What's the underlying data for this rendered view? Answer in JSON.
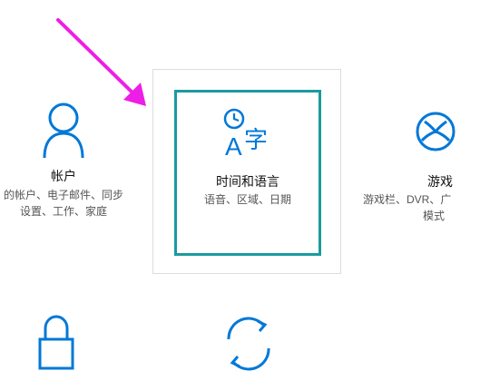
{
  "tiles": {
    "accounts": {
      "title": "帐户",
      "desc_line1": "的帐户、电子邮件、同步",
      "desc_line2": "设置、工作、家庭"
    },
    "time_language": {
      "title": "时间和语言",
      "desc": "语音、区域、日期"
    },
    "gaming": {
      "title": "游戏",
      "desc_line1": "游戏栏、DVR、广",
      "desc_line2": "模式"
    }
  },
  "colors": {
    "accent": "#0078d7",
    "focus": "#1a9aa0",
    "arrow": "#ee1ee6"
  },
  "icons": [
    "account-person-icon",
    "time-language-icon",
    "xbox-gaming-icon",
    "lock-icon",
    "sync-update-icon"
  ]
}
